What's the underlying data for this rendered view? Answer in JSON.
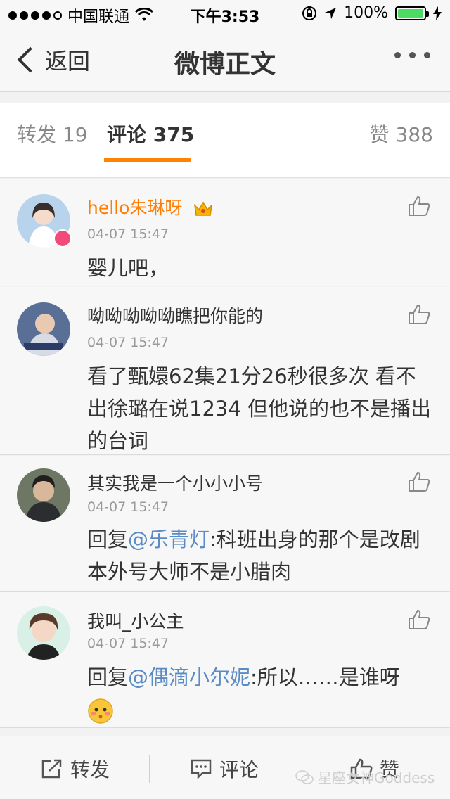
{
  "status_bar": {
    "carrier": "中国联通",
    "time": "下午3:53",
    "battery": "100%",
    "battery_level": 1.0
  },
  "nav": {
    "back_label": "返回",
    "title": "微博正文"
  },
  "tabs": {
    "repost": "转发 19",
    "comment": "评论 375",
    "like": "赞 388"
  },
  "comments": [
    {
      "name": "hello朱琳呀",
      "time": "04-07 15:47",
      "text": "婴儿吧，"
    },
    {
      "name": "呦呦呦呦呦瞧把你能的",
      "time": "04-07 15:47",
      "text": "看了甄嬛62集21分26秒很多次 看不出徐璐在说1234 但他说的也不是播出的台词"
    },
    {
      "name": "其实我是一个小小小号",
      "time": "04-07 15:47",
      "reply_prefix": "回复",
      "mention": "@乐青灯",
      "text": ":科班出身的那个是改剧本外号大师不是小腊肉"
    },
    {
      "name": "我叫_小公主",
      "time": "04-07 15:47",
      "reply_prefix": "回复",
      "mention": "@偶滴小尔妮",
      "text": ":所以……是谁呀"
    }
  ],
  "bottom_bar": {
    "repost": "转发",
    "comment": "评论",
    "like": "赞"
  },
  "watermark": "星座女神Goddess",
  "colors": {
    "accent": "#ff8200",
    "vip_name": "#ff7d00",
    "mention": "#5b8bc4",
    "battery": "#4cd964"
  }
}
